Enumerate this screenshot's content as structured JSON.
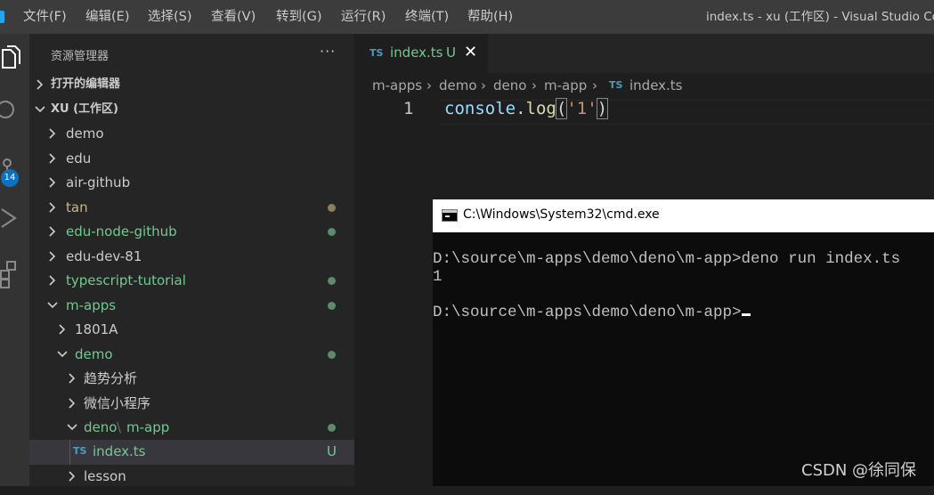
{
  "menu_bar": {
    "items": [
      "文件(F)",
      "编辑(E)",
      "选择(S)",
      "查看(V)",
      "转到(G)",
      "运行(R)",
      "终端(T)",
      "帮助(H)"
    ],
    "window_title": "index.ts - xu (工作区) - Visual Studio Co"
  },
  "activity_bar": {
    "icons": [
      "explorer-icon",
      "search-icon",
      "source-control-icon",
      "run-debug-icon",
      "extensions-icon"
    ],
    "scm_badge": "14"
  },
  "sidebar": {
    "title": "资源管理器",
    "more": "···",
    "open_editors": "打开的编辑器",
    "workspace": "XU (工作区)",
    "items": [
      {
        "label": "demo"
      },
      {
        "label": "edu"
      },
      {
        "label": "air-github"
      },
      {
        "label": "tan"
      },
      {
        "label": "edu-node-github"
      },
      {
        "label": "edu-dev-81"
      },
      {
        "label": "typescript-tutorial"
      },
      {
        "label": "m-apps"
      },
      {
        "label": "1801A"
      },
      {
        "label": "demo"
      },
      {
        "label": "趋势分析"
      },
      {
        "label": "微信小程序"
      },
      {
        "label": "deno"
      },
      {
        "label": "m-app"
      },
      {
        "label": "index.ts",
        "badge": "TS",
        "status": "U"
      },
      {
        "label": "lesson"
      }
    ],
    "colors": {
      "modified_dot": "#8a7f5f",
      "untracked": "#73c991"
    }
  },
  "editor": {
    "tab": {
      "icon": "TS",
      "name": "index.ts",
      "status": "U"
    },
    "breadcrumb": [
      "m-apps",
      "demo",
      "deno",
      "m-app",
      "index.ts"
    ],
    "breadcrumb_icon": "TS",
    "line_number": "1",
    "code": {
      "obj": "console",
      "dot": ".",
      "fn": "log",
      "open": "(",
      "str": "'1'",
      "close": ")"
    }
  },
  "cmd": {
    "title": "C:\\Windows\\System32\\cmd.exe",
    "lines": [
      "D:\\source\\m-apps\\demo\\deno\\m-app>deno run index.ts",
      "1",
      "D:\\source\\m-apps\\demo\\deno\\m-app>"
    ]
  },
  "watermark": "CSDN @徐同保"
}
